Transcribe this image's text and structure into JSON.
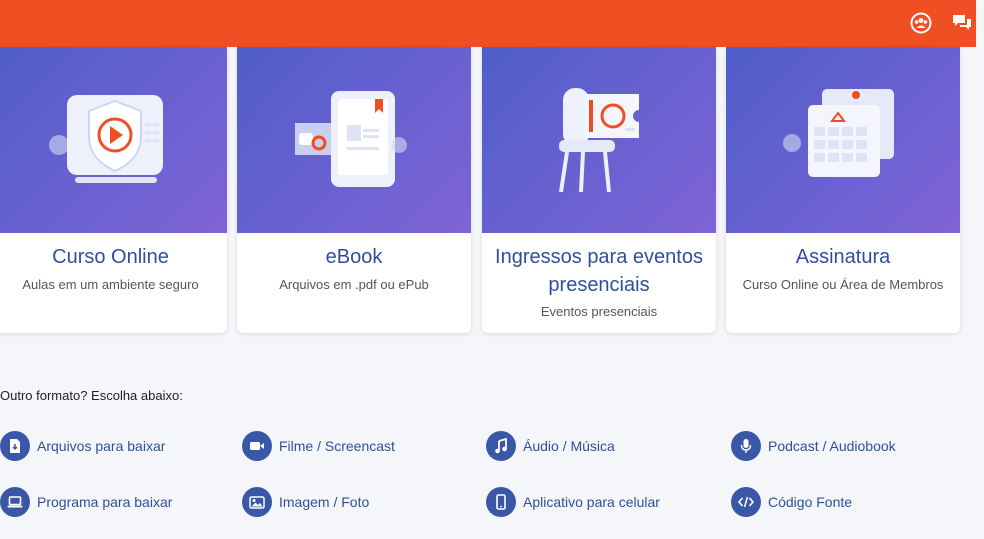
{
  "cards": [
    {
      "title_lines": [
        "Curso Online"
      ],
      "subtitle": "Aulas em um ambiente seguro",
      "icon": "video-course-icon"
    },
    {
      "title_lines": [
        "eBook"
      ],
      "subtitle": "Arquivos em .pdf ou ePub",
      "icon": "ebook-tablet-icon"
    },
    {
      "title_lines": [
        "Ingressos para eventos",
        "presenciais"
      ],
      "subtitle": "Eventos presenciais",
      "icon": "event-ticket-icon"
    },
    {
      "title_lines": [
        "Assinatura"
      ],
      "subtitle": "Curso Online ou Área de Membros",
      "icon": "subscription-calendar-icon"
    }
  ],
  "other_formats": {
    "label": "Outro formato? Escolha abaixo:",
    "items": [
      {
        "label": "Arquivos para baixar",
        "icon": "file-download-icon"
      },
      {
        "label": "Filme / Screencast",
        "icon": "video-camera-icon"
      },
      {
        "label": "Áudio / Música",
        "icon": "music-note-icon"
      },
      {
        "label": "Podcast / Audiobook",
        "icon": "microphone-icon"
      },
      {
        "label": "Programa para baixar",
        "icon": "laptop-icon"
      },
      {
        "label": "Imagem / Foto",
        "icon": "image-icon"
      },
      {
        "label": "Aplicativo para celular",
        "icon": "smartphone-icon"
      },
      {
        "label": "Código Fonte",
        "icon": "code-icon"
      }
    ]
  },
  "colors": {
    "topbar": "#f04e23",
    "accent": "#2f4f9e",
    "icon_bg": "#3a57a7"
  },
  "topbar_icons": [
    "users-circle-icon",
    "chat-bubbles-icon"
  ]
}
